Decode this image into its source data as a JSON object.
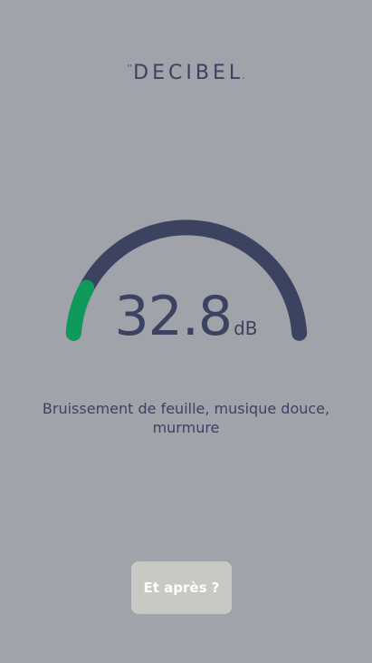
{
  "app": {
    "logo_text": "DECIBEL",
    "logo_mark": "''",
    "logo_suffix": "."
  },
  "meter": {
    "value": "32.8",
    "unit": "dB",
    "level_fraction": 0.14,
    "track_color": "#3c4361",
    "level_color": "#0e9a5a"
  },
  "description": "Bruissement de feuille, musique douce, murmure",
  "actions": {
    "next_label": "Et après ?"
  },
  "colors": {
    "background": "#a0a3a9",
    "text": "#3c4361",
    "button_background": "#c8c9c3",
    "button_text": "#ffffff"
  }
}
